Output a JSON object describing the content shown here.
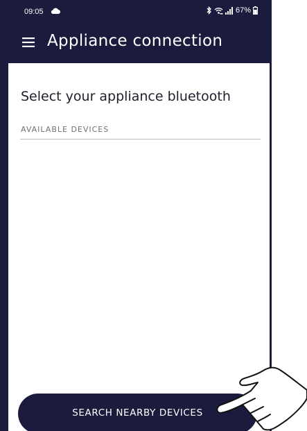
{
  "status_bar": {
    "time": "09:05",
    "battery": "67%",
    "icons": [
      "cloud-icon",
      "bluetooth-icon",
      "wifi-icon",
      "signal-icon",
      "battery-icon"
    ]
  },
  "header": {
    "title": "Appliance connection",
    "menu_icon": "menu-icon"
  },
  "main": {
    "heading": "Select your appliance bluetooth",
    "section_label": "AVAILABLE DEVICES",
    "devices": []
  },
  "footer": {
    "search_button_label": "SEARCH NEARBY DEVICES"
  },
  "overlay": {
    "pointer_icon": "pointing-hand-icon"
  },
  "colors": {
    "brand_navy": "#1b1b3d",
    "background": "#ffffff",
    "divider": "#b9b9bf",
    "label_gray": "#6f7077"
  }
}
